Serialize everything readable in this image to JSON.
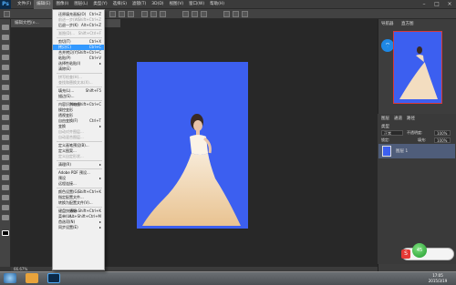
{
  "app": {
    "logo": "Ps"
  },
  "menubar": {
    "items": [
      "文件(F)",
      "编辑(E)",
      "图像(I)",
      "图层(L)",
      "类型(Y)",
      "选择(S)",
      "滤镜(T)",
      "3D(D)",
      "视图(V)",
      "窗口(W)",
      "帮助(H)"
    ],
    "active_index": 1,
    "minimize": "–",
    "maximize": "□",
    "close": "×"
  },
  "document": {
    "tab_title": "编辑文档(e...",
    "status": "66.67%"
  },
  "edit_menu": {
    "rows": [
      {
        "label": "还原填充画板(O)",
        "shortcut": "Ctrl+Z",
        "disabled": false
      },
      {
        "label": "前进一步(W)",
        "shortcut": "Shift+Ctrl+Z",
        "disabled": true
      },
      {
        "label": "后退一步(K)",
        "shortcut": "Alt+Ctrl+Z",
        "disabled": false
      },
      {
        "sep": true
      },
      {
        "label": "渐隐(D)...",
        "shortcut": "Shift+Ctrl+F",
        "disabled": true
      },
      {
        "sep": true
      },
      {
        "label": "剪切(T)",
        "shortcut": "Ctrl+X",
        "disabled": false
      },
      {
        "label": "拷贝(C)",
        "shortcut": "Ctrl+C",
        "disabled": false,
        "highlight": true
      },
      {
        "label": "合并拷贝(Y)",
        "shortcut": "Shift+Ctrl+C",
        "disabled": false
      },
      {
        "label": "粘贴(P)",
        "shortcut": "Ctrl+V",
        "disabled": false
      },
      {
        "label": "选择性粘贴(I)",
        "shortcut": "",
        "disabled": false,
        "submenu": true
      },
      {
        "label": "清除(E)",
        "shortcut": "",
        "disabled": false
      },
      {
        "sep": true
      },
      {
        "label": "拼写检查(H)...",
        "shortcut": "",
        "disabled": true
      },
      {
        "label": "查找和替换文本(X)...",
        "shortcut": "",
        "disabled": true
      },
      {
        "sep": true
      },
      {
        "label": "填充(L)...",
        "shortcut": "Shift+F5",
        "disabled": false
      },
      {
        "label": "描边(S)...",
        "shortcut": "",
        "disabled": false
      },
      {
        "sep": true
      },
      {
        "label": "内容识别缩放",
        "shortcut": "Alt+Shift+Ctrl+C",
        "disabled": false
      },
      {
        "label": "操控变形",
        "shortcut": "",
        "disabled": false
      },
      {
        "label": "透视变形",
        "shortcut": "",
        "disabled": false
      },
      {
        "label": "自由变换(F)",
        "shortcut": "Ctrl+T",
        "disabled": false
      },
      {
        "label": "变换",
        "shortcut": "",
        "disabled": false,
        "submenu": true
      },
      {
        "label": "自动对齐图层...",
        "shortcut": "",
        "disabled": true
      },
      {
        "label": "自动混合图层...",
        "shortcut": "",
        "disabled": true
      },
      {
        "sep": true
      },
      {
        "label": "定义画笔预设(B)...",
        "shortcut": "",
        "disabled": false
      },
      {
        "label": "定义图案...",
        "shortcut": "",
        "disabled": false
      },
      {
        "label": "定义自定形状...",
        "shortcut": "",
        "disabled": true
      },
      {
        "sep": true
      },
      {
        "label": "清理(R)",
        "shortcut": "",
        "disabled": false,
        "submenu": true
      },
      {
        "sep": true
      },
      {
        "label": "Adobe PDF 预设...",
        "shortcut": "",
        "disabled": false
      },
      {
        "label": "预设",
        "shortcut": "",
        "disabled": false,
        "submenu": true
      },
      {
        "label": "远程连接...",
        "shortcut": "",
        "disabled": false
      },
      {
        "sep": true
      },
      {
        "label": "颜色设置(G)...",
        "shortcut": "Shift+Ctrl+K",
        "disabled": false
      },
      {
        "label": "指定配置文件...",
        "shortcut": "",
        "disabled": false
      },
      {
        "label": "转换为配置文件(V)...",
        "shortcut": "",
        "disabled": false
      },
      {
        "sep": true
      },
      {
        "label": "键盘快捷键...",
        "shortcut": "Alt+Shift+Ctrl+K",
        "disabled": false
      },
      {
        "label": "菜单(U)...",
        "shortcut": "Alt+Shift+Ctrl+M",
        "disabled": false
      },
      {
        "label": "首选项(N)",
        "shortcut": "",
        "disabled": false,
        "submenu": true
      },
      {
        "label": "同步设置(E)",
        "shortcut": "",
        "disabled": false,
        "submenu": true
      }
    ]
  },
  "panels": {
    "navigator_tabs": [
      "导航器",
      "直方图"
    ],
    "layers_tabs": [
      "图层",
      "通道",
      "路径"
    ],
    "blend_mode": "正常",
    "opacity_label": "不透明度:",
    "opacity": "100%",
    "fill_label": "填充:",
    "fill": "100%",
    "lock_label": "锁定:",
    "kind_label": "类型",
    "layer_name": "图层 1"
  },
  "widget": {
    "logo": "S",
    "status": "45"
  },
  "taskbar": {
    "time": "17:05",
    "date": "2015/3/19"
  },
  "colors": {
    "canvas_blue": "#3c5ff0",
    "menu_highlight": "#3399ff",
    "ui_dark": "#353535"
  }
}
